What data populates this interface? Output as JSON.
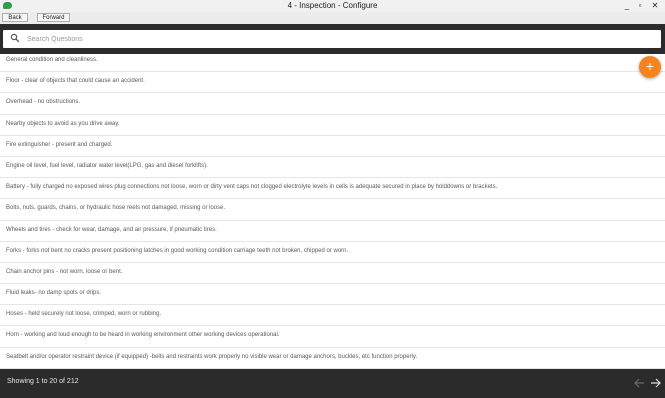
{
  "window": {
    "title": "4 - Inspection - Configure",
    "minimize_label": "_",
    "maximize_label": "▫",
    "close_label": "✕"
  },
  "toolbar": {
    "back_label": "Back",
    "forward_label": "Forward"
  },
  "search": {
    "placeholder": "Search Questions",
    "value": ""
  },
  "fab": {
    "label": "+"
  },
  "questions": [
    "General condition and cleanliness.",
    "Floor - clear of objects that could cause an accident.",
    "Overhead - no obstructions.",
    "Nearby objects to avoid as you drive away.",
    "Fire extinguisher - present and charged.",
    "Engine oil level, fuel level, radiator water level(LPG, gas and diesel forklifts).",
    "Battery - fully charged no exposed wires plug connections not loose, worn or dirty vent caps not clogged electrolyte levels in cells is adequate secured in place by holddowns or brackets.",
    "Bolts, nuts, guards, chains, or hydraulic hose reels not damaged, missing or loose.",
    "Wheels and tires - check for wear, damage, and air pressure, if pneumatic tires.",
    "Forks - forks not bent no cracks present positioning latches in good working condition carriage teeth not broken, chipped or worn.",
    "Chain anchor pins - not worn, loose or bent.",
    "Fluid leaks- no damp spots or drips.",
    "Hoses - held securely not loose, crimped, worn or rubbing.",
    "Horn - working and loud enough to be heard in working environment other working devices operational.",
    "Seatbelt and/or operator restraint device (if equipped) -belts and restraints work properly no visible wear or damage anchors, buckles, etc function properly."
  ],
  "footer": {
    "status_text": "Showing 1 to 20 of 212"
  }
}
